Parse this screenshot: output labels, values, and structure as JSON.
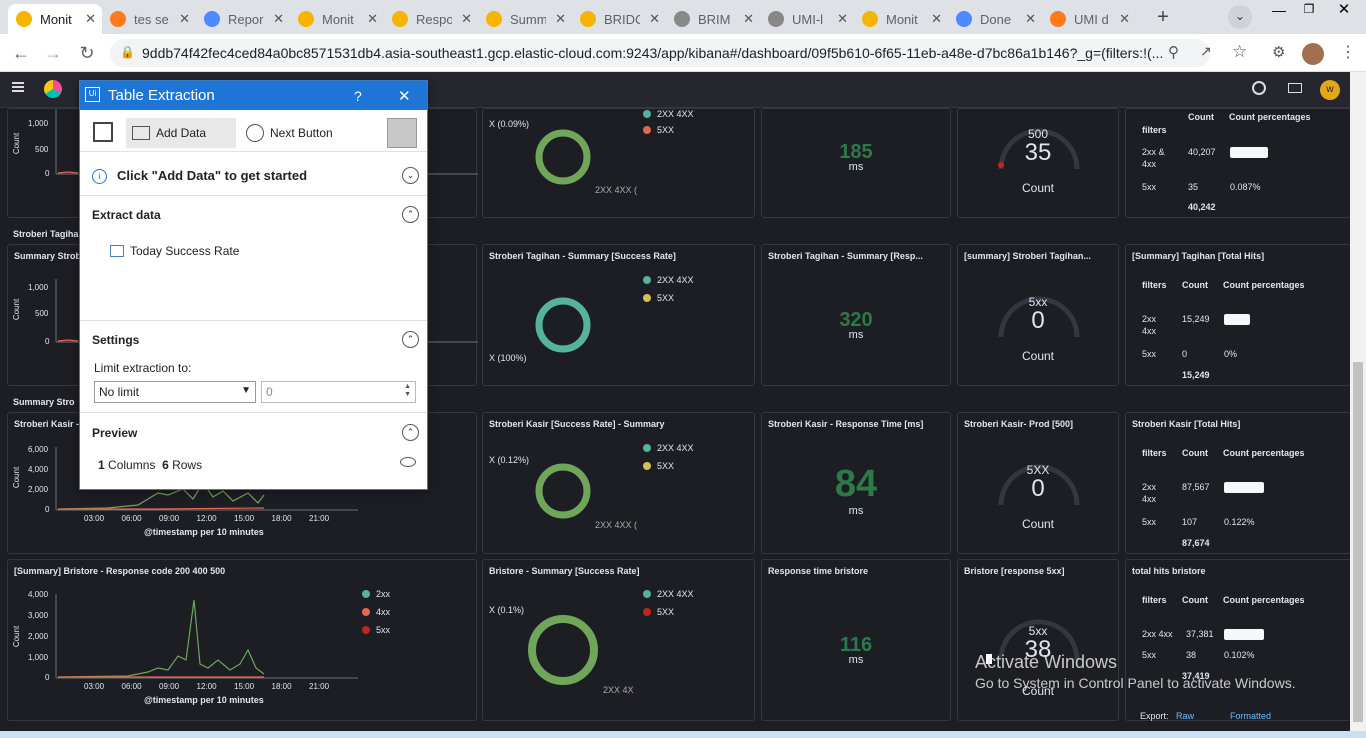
{
  "browser": {
    "tabs": [
      {
        "title": "Monit",
        "fav": "#f5b400",
        "active": true
      },
      {
        "title": "tes se",
        "fav": "#ff7a1a"
      },
      {
        "title": "Repor",
        "fav": "#4d89ff"
      },
      {
        "title": "Monit",
        "fav": "#f5b400"
      },
      {
        "title": "Respo",
        "fav": "#f5b400"
      },
      {
        "title": "Summ",
        "fav": "#f5b400"
      },
      {
        "title": "BRIDC",
        "fav": "#f5b400"
      },
      {
        "title": "BRIM",
        "fav": "#888"
      },
      {
        "title": "UMI-l",
        "fav": "#888"
      },
      {
        "title": "Monit",
        "fav": "#f5b400"
      },
      {
        "title": "Done",
        "fav": "#4d89ff"
      },
      {
        "title": "UMI d",
        "fav": "#ff7a1a"
      }
    ],
    "new_tab": "+",
    "url": "9ddb74f42fec4ced84a0bc8571531db4.asia-southeast1.gcp.elastic-cloud.com:9243/app/kibana#/dashboard/09f5b610-6f65-11eb-a48e-d7bc86a1b146?_g=(filters:!(..."
  },
  "kibana": {
    "avatar": "w"
  },
  "dialog": {
    "title": "Table Extraction",
    "help": "?",
    "close": "✕",
    "add_data": "Add Data",
    "next_button": "Next Button",
    "hint": "Click \"Add Data\" to get started",
    "extract_data": "Extract data",
    "extract_item": "Today Success Rate",
    "settings": "Settings",
    "limit_label": "Limit extraction to:",
    "limit_value": "No limit",
    "limit_num": "0",
    "preview": "Preview",
    "columns_n": "1",
    "columns_label": "Columns",
    "rows_n": "6",
    "rows_label": "Rows"
  },
  "sections": {
    "s1": "Stroberi Tagiha",
    "s2": "Summary Strob",
    "s3": "Summary Stro",
    "s4": "Stroberi Kasir -"
  },
  "rows": [
    {
      "donut_label": "X (0.09%)",
      "donut_sub": "2XX 4XX (",
      "legend": [
        {
          "n": "2XX 4XX",
          "c": "#54b399"
        },
        {
          "n": "5XX",
          "c": "#e7664c"
        }
      ],
      "resp_val": "185",
      "resp_unit": "ms",
      "gauge_top": "500",
      "gauge_val": "35",
      "gauge_cnt": "Count",
      "tbl": {
        "h1": "filters",
        "h2": "Count",
        "h3": "Count percentages",
        "r1a": "2xx &",
        "r1b": "4xx",
        "r1c": "40,207",
        "r2a": "5xx",
        "r2c": "35",
        "r2p": "0.087%",
        "tot": "40,242"
      }
    },
    {
      "donut_title": "Stroberi Tagihan - Summary [Success Rate]",
      "donut_label": "X (100%)",
      "legend": [
        {
          "n": "2XX 4XX",
          "c": "#54b399"
        },
        {
          "n": "5XX",
          "c": "#d6bf57"
        }
      ],
      "resp_title": "Stroberi Tagihan - Summary [Resp...",
      "resp_val": "320",
      "resp_unit": "ms",
      "gauge_title": "[summary] Stroberi Tagihan...",
      "gauge_top": "5xx",
      "gauge_val": "0",
      "gauge_cnt": "Count",
      "tbl_title": "[Summary] Tagihan [Total Hits]",
      "tbl": {
        "h1": "filters",
        "h2": "Count",
        "h3": "Count percentages",
        "r1a": "2xx",
        "r1b": "4xx",
        "r1c": "15,249",
        "r2a": "5xx",
        "r2c": "0",
        "r2p": "0%",
        "tot": "15,249"
      }
    },
    {
      "donut_title": "Stroberi Kasir [Success Rate] - Summary",
      "donut_label": "X (0.12%)",
      "donut_sub": "2XX 4XX (",
      "legend": [
        {
          "n": "2XX 4XX",
          "c": "#54b399"
        },
        {
          "n": "5XX",
          "c": "#d6bf57"
        }
      ],
      "resp_title": "Stroberi Kasir - Response Time [ms]",
      "resp_val": "84",
      "resp_unit": "ms",
      "gauge_title": "Stroberi Kasir- Prod [500]",
      "gauge_top": "5XX",
      "gauge_val": "0",
      "gauge_cnt": "Count",
      "tbl_title": "Stroberi Kasir [Total Hits]",
      "tbl": {
        "h1": "filters",
        "h2": "Count",
        "h3": "Count percentages",
        "r1a": "2xx",
        "r1b": "4xx",
        "r1c": "87,567",
        "r2a": "5xx",
        "r2c": "107",
        "r2p": "0.122%",
        "tot": "87,674"
      }
    },
    {
      "line_title": "[Summary] Bristore - Response code 200 400 500",
      "donut_title": "Bristore - Summary [Success Rate]",
      "donut_label": "X (0.1%)",
      "donut_sub": "2XX 4X",
      "legend": [
        {
          "n": "2XX 4XX",
          "c": "#54b399"
        },
        {
          "n": "5XX",
          "c": "#bd271e"
        }
      ],
      "resp_title": "Response time bristore",
      "resp_val": "116",
      "resp_unit": "ms",
      "gauge_title": "Bristore [response 5xx]",
      "gauge_top": "5xx",
      "gauge_val": "38",
      "gauge_cnt": "Count",
      "tbl_title": "total hits bristore",
      "tbl": {
        "h1": "filters",
        "h2": "Count",
        "h3": "Count percentages",
        "r1a": "2xx 4xx",
        "r1c": "37,381",
        "r2a": "5xx",
        "r2c": "38",
        "r2p": "0.102%",
        "tot": "37,419"
      },
      "export": "Export:",
      "raw": "Raw",
      "formatted": "Formatted"
    }
  ],
  "line_charts": {
    "count_label": "Count",
    "xlabel": "@timestamp per 10 minutes",
    "xticks": [
      "03:00",
      "06:00",
      "09:00",
      "12:00",
      "15:00",
      "18:00",
      "21:00"
    ],
    "c1_yticks": [
      "1,000",
      "500",
      "0"
    ],
    "c2_yticks": [
      "1,000",
      "500",
      "0"
    ],
    "c3_yticks": [
      "6,000",
      "4,000",
      "2,000",
      "0"
    ],
    "c4_yticks": [
      "4,000",
      "3,000",
      "2,000",
      "1,000",
      "0"
    ],
    "c4_legend": [
      {
        "n": "2xx",
        "c": "#54b399"
      },
      {
        "n": "4xx",
        "c": "#e7664c"
      },
      {
        "n": "5xx",
        "c": "#bd271e"
      }
    ]
  },
  "watermark": {
    "line1": "Activate Windows",
    "line2": "Go to System in Control Panel to activate Windows."
  }
}
